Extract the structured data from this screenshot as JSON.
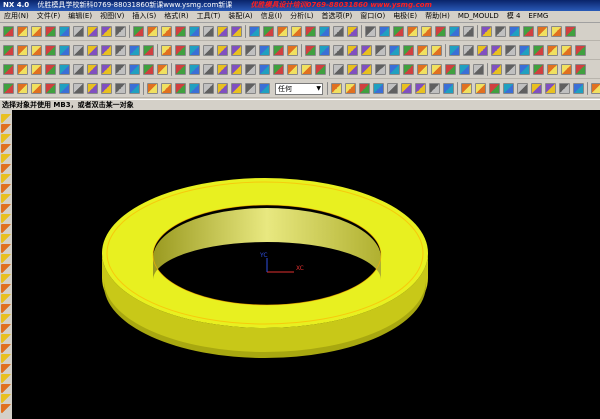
{
  "window": {
    "title": "NX 4.0",
    "title_rest": "优胜模具学校新科0769-88031860新课www.ysmg.com新课",
    "watermark": "优胜模具设计培训0769-88031860 www.ysmg.com"
  },
  "menu": {
    "items": [
      "应用(N)",
      "文件(F)",
      "编辑(E)",
      "视图(V)",
      "插入(S)",
      "格式(R)",
      "工具(T)",
      "装配(A)",
      "信息(I)",
      "分析(L)",
      "首选项(P)",
      "窗口(O)",
      "电极(E)",
      "帮助(H)",
      "MD_MOULD",
      "模 4",
      "EFMG"
    ]
  },
  "toolbar": {
    "layer_dropdown": "任何"
  },
  "cue_line": {
    "text": "选择对象并使用 MB3，或者双击某一对象"
  },
  "viewport": {
    "background": "#000000",
    "ring_top_color": "#e8f020",
    "ring_side_color": "#c8c818",
    "axes": {
      "x_label": "XC",
      "y_label": "YC",
      "x_color": "#e03030",
      "y_color": "#3050e0"
    }
  }
}
